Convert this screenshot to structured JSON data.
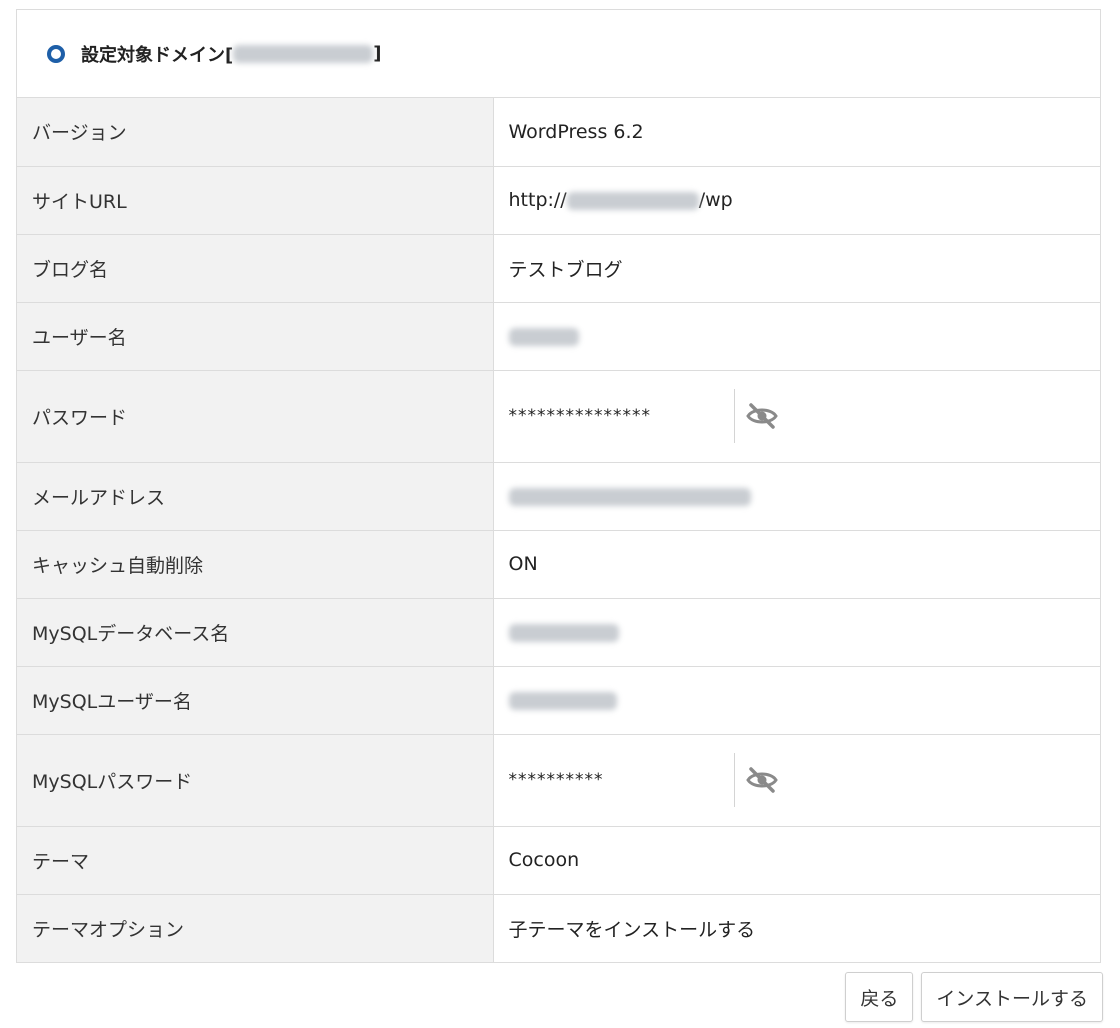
{
  "header": {
    "title_prefix": "設定対象ドメイン[",
    "title_suffix": "]"
  },
  "rows": {
    "version": {
      "label": "バージョン",
      "value": "WordPress 6.2"
    },
    "site_url": {
      "label": "サイトURL",
      "value_prefix": "http://",
      "value_suffix": "/wp"
    },
    "blog_name": {
      "label": "ブログ名",
      "value": "テストブログ"
    },
    "user_name": {
      "label": "ユーザー名"
    },
    "password": {
      "label": "パスワード",
      "value": "***************"
    },
    "email": {
      "label": "メールアドレス"
    },
    "cache": {
      "label": "キャッシュ自動削除",
      "value": "ON"
    },
    "db_name": {
      "label": "MySQLデータベース名"
    },
    "db_user": {
      "label": "MySQLユーザー名"
    },
    "db_password": {
      "label": "MySQLパスワード",
      "value": "**********"
    },
    "theme": {
      "label": "テーマ",
      "value": "Cocoon"
    },
    "theme_option": {
      "label": "テーマオプション",
      "value": "子テーマをインストールする"
    }
  },
  "buttons": {
    "back": "戻る",
    "install": "インストールする"
  },
  "icons": {
    "header": "circle-icon",
    "toggle_password": "eye-slash-icon"
  },
  "colors": {
    "accent": "#1e5fa8",
    "label_bg": "#f2f2f2",
    "border": "#dcdcdc"
  }
}
